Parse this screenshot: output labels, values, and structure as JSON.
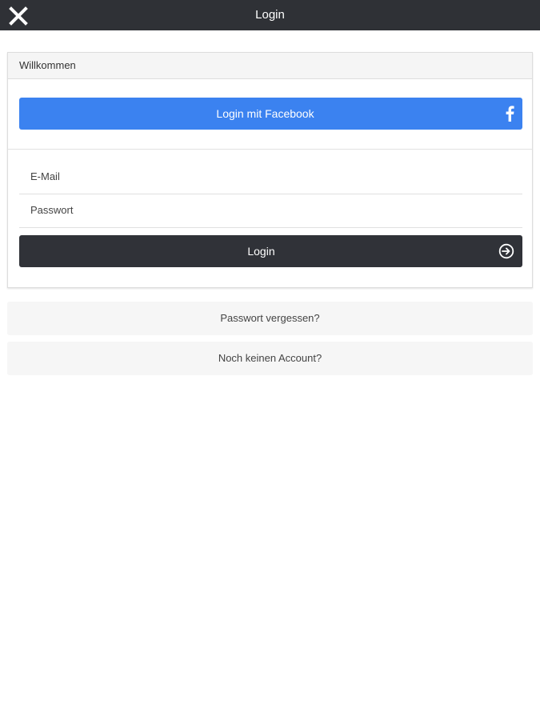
{
  "header": {
    "title": "Login",
    "close_icon": "close-icon"
  },
  "panel": {
    "heading": "Willkommen",
    "facebook_button": {
      "label": "Login mit Facebook",
      "icon": "facebook-icon",
      "color": "#3b82f0"
    },
    "email_field": {
      "placeholder": "E-Mail",
      "value": ""
    },
    "password_field": {
      "placeholder": "Passwort",
      "value": ""
    },
    "login_button": {
      "label": "Login",
      "icon": "login-arrow-icon",
      "color": "#303238"
    }
  },
  "links": {
    "forgot_password": "Passwort vergessen?",
    "no_account": "Noch keinen Account?"
  }
}
